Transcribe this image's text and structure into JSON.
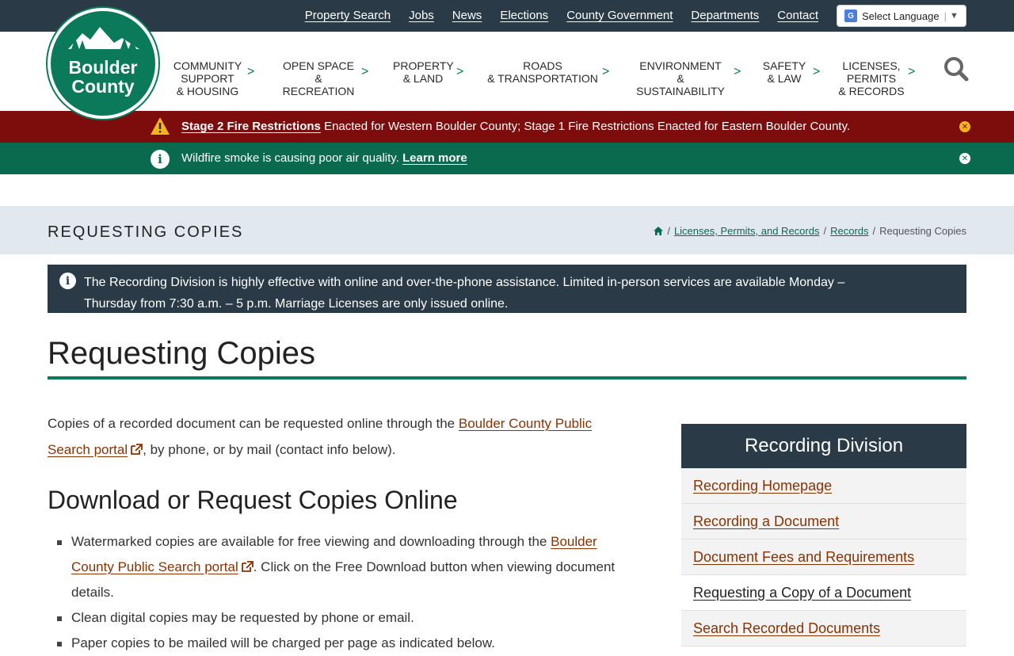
{
  "topbar": {
    "links": [
      "Property Search",
      "Jobs",
      "News",
      "Elections",
      "County Government",
      "Departments",
      "Contact"
    ],
    "language": "Select Language"
  },
  "logo": {
    "line1": "Boulder",
    "line2": "County"
  },
  "nav": {
    "items": [
      {
        "l1": "COMMUNITY",
        "l2": "SUPPORT",
        "l3": "& HOUSING"
      },
      {
        "l1": "OPEN SPACE",
        "l2": "& RECREATION",
        "l3": ""
      },
      {
        "l1": "PROPERTY",
        "l2": "& LAND",
        "l3": ""
      },
      {
        "l1": "ROADS",
        "l2": "& TRANSPORTATION",
        "l3": ""
      },
      {
        "l1": "ENVIRONMENT",
        "l2": "& SUSTAINABILITY",
        "l3": ""
      },
      {
        "l1": "SAFETY",
        "l2": "& LAW",
        "l3": ""
      },
      {
        "l1": "LICENSES,",
        "l2": "PERMITS",
        "l3": "& RECORDS"
      }
    ],
    "chevron": ">"
  },
  "alerts": {
    "fire": {
      "link": "Stage 2 Fire Restrictions",
      "text": " Enacted for Western Boulder County; Stage 1 Fire Restrictions Enacted for Eastern Boulder County."
    },
    "smoke": {
      "text": "Wildfire smoke is causing poor air quality. ",
      "link": "Learn more"
    },
    "close": "✕"
  },
  "page": {
    "banner_title": "REQUESTING COPIES",
    "breadcrumbs": [
      "Licenses, Permits, and Records",
      "Records",
      "Requesting Copies"
    ],
    "notice": "The Recording Division is highly effective with online and over-the-phone assistance. Limited in-person services are available Monday – Thursday from 7:30 a.m. – 5 p.m. Marriage Licenses are only issued online.",
    "title": "Requesting Copies",
    "intro_before": "Copies of a recorded document can be requested online through the ",
    "intro_link": "Boulder County Public Search portal",
    "intro_after": ", by phone, or by mail (contact info below).",
    "h2": "Download or Request Copies Online",
    "bullets": {
      "b1_before": "Watermarked copies are available for free viewing and downloading through the ",
      "b1_link": "Boulder County Public Search portal",
      "b1_after": ". Click on the Free Download button when viewing document details.",
      "b2": "Clean digital copies may be requested by phone or email.",
      "b3": "Paper copies to be mailed will be charged per page as indicated below."
    }
  },
  "sidebar": {
    "title": "Recording Division",
    "items": [
      "Recording Homepage",
      "Recording a Document",
      "Document Fees and Requirements",
      "Requesting a Copy of a Document",
      "Search Recorded Documents"
    ]
  },
  "colors": {
    "green": "#0a7a5a",
    "dark": "#2a3b47",
    "alert_red": "#7d0c0c",
    "link": "#8a3200"
  }
}
